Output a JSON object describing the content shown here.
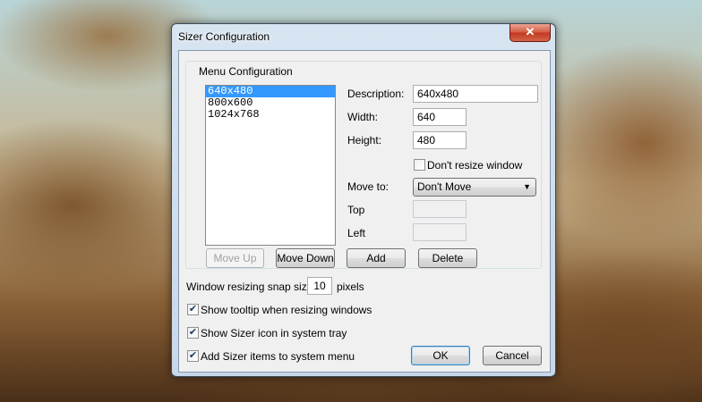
{
  "window": {
    "title": "Sizer Configuration",
    "close_glyph": "✕"
  },
  "menu_config": {
    "legend": "Menu Configuration",
    "list_items": [
      "640x480",
      "800x600",
      "1024x768"
    ],
    "selected_index": 0,
    "description_label": "Description:",
    "description_value": "640x480",
    "width_label": "Width:",
    "width_value": "640",
    "height_label": "Height:",
    "height_value": "480",
    "dont_resize_label": "Don't resize window",
    "dont_resize_checked": false,
    "move_to_label": "Move to:",
    "move_to_value": "Don't Move",
    "top_label": "Top",
    "top_value": "",
    "left_label": "Left",
    "left_value": "",
    "move_up_label": "Move Up",
    "move_down_label": "Move Down",
    "add_label": "Add",
    "delete_label": "Delete"
  },
  "options": {
    "snap_label": "Window resizing snap size:",
    "snap_value": "10",
    "snap_unit": "pixels",
    "tooltip_label": "Show tooltip when resizing windows",
    "tooltip_checked": true,
    "tray_label": "Show Sizer icon in system tray",
    "tray_checked": true,
    "sysmenu_label": "Add Sizer items to system menu",
    "sysmenu_checked": true,
    "check_glyph": "✔"
  },
  "dialog_buttons": {
    "ok_label": "OK",
    "cancel_label": "Cancel"
  }
}
